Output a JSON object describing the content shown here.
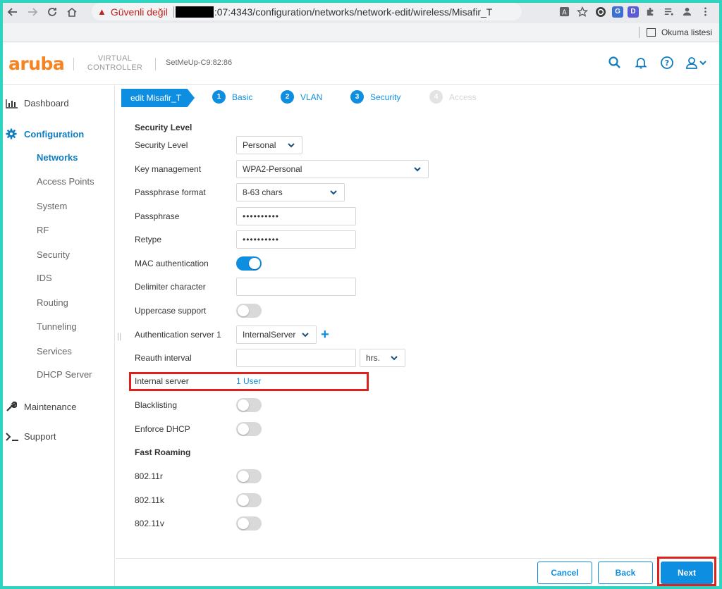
{
  "browser": {
    "security_warning": "Güvenli değil",
    "url_visible": ":07:4343/configuration/networks/network-edit/wireless/Misafir_T",
    "reading_list": "Okuma listesi",
    "ext_labels": [
      "G",
      "D"
    ]
  },
  "header": {
    "logo": "aruba",
    "product_line1": "VIRTUAL",
    "product_line2": "CONTROLLER",
    "device": "SetMeUp-C9:82:86"
  },
  "sidebar": {
    "dashboard": "Dashboard",
    "configuration": "Configuration",
    "sub": [
      "Networks",
      "Access Points",
      "System",
      "RF",
      "Security",
      "IDS",
      "Routing",
      "Tunneling",
      "Services",
      "DHCP Server"
    ],
    "maintenance": "Maintenance",
    "support": "Support"
  },
  "wizard": {
    "edit_label": "edit Misafir_T",
    "steps": [
      {
        "num": "1",
        "label": "Basic"
      },
      {
        "num": "2",
        "label": "VLAN"
      },
      {
        "num": "3",
        "label": "Security"
      },
      {
        "num": "4",
        "label": "Access"
      }
    ]
  },
  "form": {
    "section_security": "Security Level",
    "security_level": {
      "label": "Security Level",
      "value": "Personal"
    },
    "key_management": {
      "label": "Key management",
      "value": "WPA2-Personal"
    },
    "passphrase_format": {
      "label": "Passphrase format",
      "value": "8-63 chars"
    },
    "passphrase": {
      "label": "Passphrase",
      "value": "••••••••••"
    },
    "retype": {
      "label": "Retype",
      "value": "••••••••••"
    },
    "mac_auth": {
      "label": "MAC authentication",
      "on": true
    },
    "delimiter": {
      "label": "Delimiter character",
      "value": ""
    },
    "uppercase": {
      "label": "Uppercase support",
      "on": false
    },
    "auth_server": {
      "label": "Authentication server 1",
      "value": "InternalServer",
      "plus": "+"
    },
    "reauth": {
      "label": "Reauth interval",
      "value": "",
      "unit": "hrs."
    },
    "internal_server": {
      "label": "Internal server",
      "link": "1 User"
    },
    "blacklisting": {
      "label": "Blacklisting",
      "on": false
    },
    "enforce_dhcp": {
      "label": "Enforce DHCP",
      "on": false
    },
    "section_fast_roaming": "Fast Roaming",
    "r80211r": {
      "label": "802.11r",
      "on": false
    },
    "r80211k": {
      "label": "802.11k",
      "on": false
    },
    "r80211v": {
      "label": "802.11v",
      "on": false
    }
  },
  "footer": {
    "cancel": "Cancel",
    "back": "Back",
    "next": "Next"
  },
  "colors": {
    "accent": "#0e8ee0",
    "logo": "#f5831f",
    "highlight": "#e0201d",
    "frame": "#2dd4c0"
  }
}
